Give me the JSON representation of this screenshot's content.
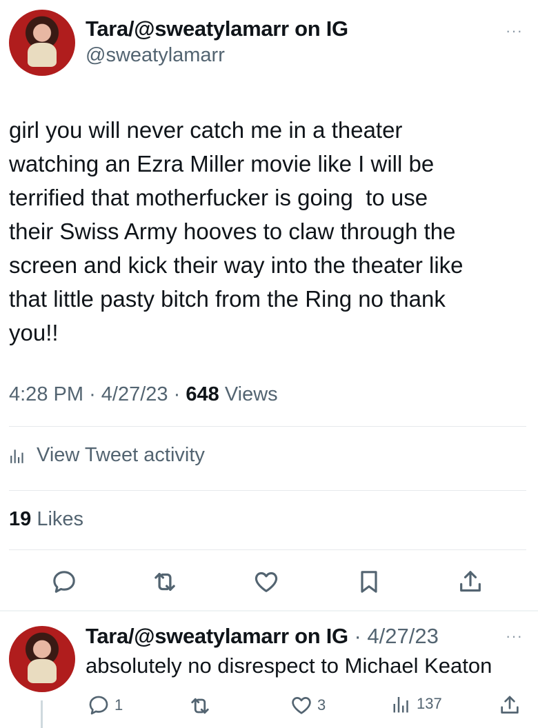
{
  "tweet": {
    "display_name": "Tara/@sweatylamarr on IG",
    "handle": "@sweatylamarr",
    "more_icon": "···",
    "text": "girl you will never catch me in a theater\nwatching an Ezra Miller movie like I will be\nterrified that motherfucker is going  to use\ntheir Swiss Army hooves to claw through the\nscreen and kick their way into the theater like\nthat little pasty bitch from the Ring no thank\nyou!!",
    "time": "4:28 PM",
    "sep1": "·",
    "date": "4/27/23",
    "sep2": "·",
    "views_count": "648",
    "views_label": "Views",
    "activity_label": "View Tweet activity",
    "likes_count": "19",
    "likes_label": "Likes",
    "actions": [
      "reply-icon",
      "retweet-icon",
      "like-icon",
      "bookmark-icon",
      "share-icon"
    ]
  },
  "reply": {
    "display_name": "Tara/@sweatylamarr on IG",
    "sep": "·",
    "date": "4/27/23",
    "more_icon": "···",
    "text": "absolutely no disrespect to Michael Keaton",
    "reply_count": "1",
    "like_count": "3",
    "view_count": "137"
  },
  "colors": {
    "text": "#0f1419",
    "secondary": "#536471",
    "divider": "#eff3f4"
  }
}
